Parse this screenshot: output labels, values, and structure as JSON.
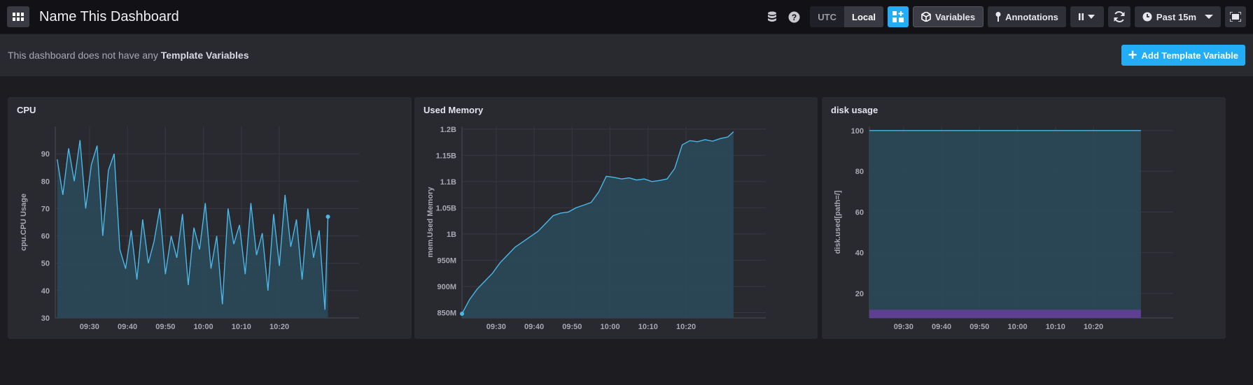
{
  "header": {
    "title": "Name This Dashboard",
    "tz_utc": "UTC",
    "tz_local": "Local",
    "variables_label": "Variables",
    "annotations_label": "Annotations",
    "time_range": "Past 15m"
  },
  "template_bar": {
    "message": "This dashboard does not have any ",
    "message_bold": "Template Variables",
    "add_label": "Add Template Variable"
  },
  "colors": {
    "accent": "#22adf6",
    "series": "#4ab8e8",
    "fill": "#2a4b5c",
    "purple": "#6b3fa0"
  },
  "cells": [
    {
      "name": "CPU",
      "chart_data": {
        "type": "line",
        "ylabel": "cpu.CPU Usage",
        "ylim": [
          30,
          100
        ],
        "yticks": [
          30,
          40,
          50,
          60,
          70,
          80,
          90
        ],
        "xticks": [
          "09:30",
          "09:40",
          "09:50",
          "10:00",
          "10:10",
          "10:20"
        ],
        "xrange_min": [
          21,
          101
        ],
        "x_min": [
          21.5,
          23,
          24.5,
          26,
          27.5,
          29,
          30.5,
          32,
          33.5,
          35,
          36.5,
          38,
          39.5,
          41,
          42.5,
          44,
          45.5,
          47,
          48.5,
          50,
          51.5,
          53,
          54.5,
          56,
          57.5,
          59,
          60.5,
          62,
          63.5,
          65,
          66.5,
          68,
          69.5,
          71,
          72.5,
          74,
          75.5,
          77,
          78.5,
          80,
          81.5,
          83,
          84.5,
          86,
          87.5,
          89,
          90.5,
          92,
          92.8
        ],
        "values": [
          88,
          75,
          92,
          80,
          95,
          70,
          86,
          93,
          60,
          84,
          90,
          55,
          48,
          62,
          44,
          66,
          50,
          58,
          70,
          46,
          60,
          52,
          68,
          42,
          63,
          55,
          72,
          48,
          60,
          35,
          70,
          57,
          64,
          46,
          72,
          53,
          61,
          40,
          68,
          49,
          75,
          56,
          66,
          44,
          70,
          52,
          62,
          33,
          67
        ]
      }
    },
    {
      "name": "Used Memory",
      "chart_data": {
        "type": "line",
        "ylabel": "mem.Used Memory",
        "ytick_labels": [
          "850M",
          "900M",
          "950M",
          "1B",
          "1.05B",
          "1.1B",
          "1.15B",
          "1.2B"
        ],
        "ytick_values": [
          850,
          900,
          950,
          1000,
          1050,
          1100,
          1150,
          1200
        ],
        "ylim": [
          840,
          1205
        ],
        "xticks": [
          "09:30",
          "09:40",
          "09:50",
          "10:00",
          "10:10",
          "10:20"
        ],
        "xrange_min": [
          21,
          101
        ],
        "x_min": [
          21,
          23,
          25,
          27,
          29,
          31,
          33,
          35,
          37,
          39,
          41,
          43,
          45,
          47,
          49,
          51,
          53,
          55,
          57,
          59,
          61,
          63,
          65,
          67,
          69,
          71,
          73,
          75,
          77,
          79,
          81,
          83,
          85,
          87,
          89,
          91,
          92.5
        ],
        "values": [
          848,
          875,
          895,
          910,
          925,
          945,
          960,
          975,
          985,
          995,
          1005,
          1020,
          1035,
          1040,
          1042,
          1050,
          1055,
          1060,
          1080,
          1110,
          1108,
          1105,
          1107,
          1103,
          1105,
          1100,
          1102,
          1105,
          1125,
          1170,
          1178,
          1176,
          1180,
          1177,
          1182,
          1185,
          1195
        ]
      }
    },
    {
      "name": "disk usage",
      "chart_data": {
        "type": "area",
        "ylabel": "disk.used[path=/]",
        "ylim": [
          8,
          102
        ],
        "yticks": [
          20,
          40,
          60,
          80,
          100
        ],
        "xticks": [
          "09:30",
          "09:40",
          "09:50",
          "10:00",
          "10:10",
          "10:20"
        ],
        "xrange_min": [
          21,
          101
        ],
        "series": [
          {
            "name": "",
            "x_min": [
              21,
              92.5
            ],
            "values": [
              100,
              100
            ]
          },
          {
            "name": "",
            "x_min": [
              21,
              92.5
            ],
            "values": [
              12,
              12
            ]
          }
        ]
      }
    }
  ]
}
